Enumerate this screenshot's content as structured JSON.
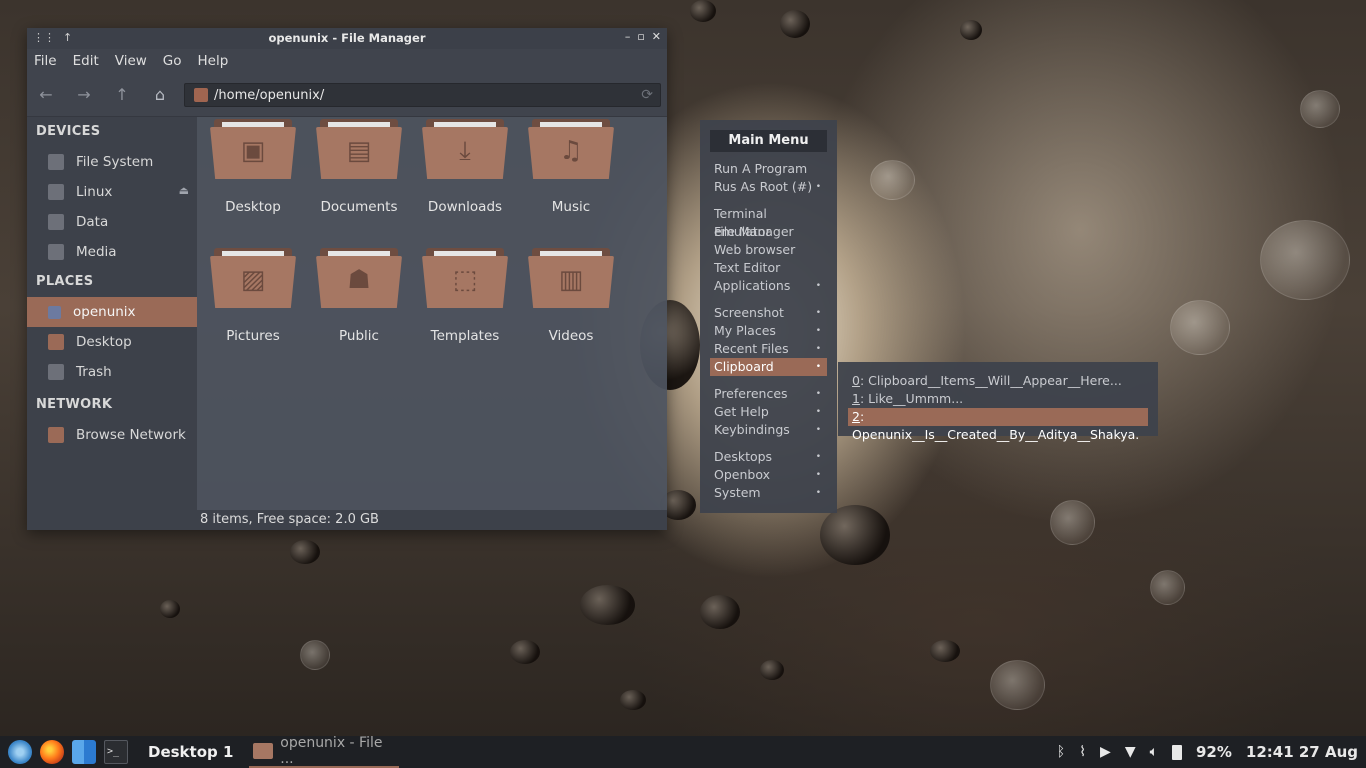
{
  "window": {
    "title": "openunix - File Manager",
    "menu": [
      "File",
      "Edit",
      "View",
      "Go",
      "Help"
    ],
    "path": "/home/openunix/",
    "status": "8 items, Free space: 2.0 GB"
  },
  "sidebar": {
    "devices_header": "DEVICES",
    "devices": [
      "File System",
      "Linux",
      "Data",
      "Media"
    ],
    "places_header": "PLACES",
    "places": [
      "openunix",
      "Desktop",
      "Trash"
    ],
    "network_header": "NETWORK",
    "network": [
      "Browse Network"
    ]
  },
  "folders": [
    {
      "label": "Desktop",
      "icon": "monitor-icon"
    },
    {
      "label": "Documents",
      "icon": "document-icon"
    },
    {
      "label": "Downloads",
      "icon": "download-icon"
    },
    {
      "label": "Music",
      "icon": "music-icon"
    },
    {
      "label": "Pictures",
      "icon": "image-icon"
    },
    {
      "label": "Public",
      "icon": "people-icon"
    },
    {
      "label": "Templates",
      "icon": "template-icon"
    },
    {
      "label": "Videos",
      "icon": "film-icon"
    }
  ],
  "main_menu": {
    "title": "Main Menu",
    "groups": [
      [
        "Run A Program",
        "Rus As Root (#)"
      ],
      [
        "Terminal emulator",
        "File Manager",
        "Web browser",
        "Text Editor",
        "Applications"
      ],
      [
        "Screenshot",
        "My Places",
        "Recent Files",
        "Clipboard"
      ],
      [
        "Preferences",
        "Get Help",
        "Keybindings"
      ],
      [
        "Desktops",
        "Openbox",
        "System"
      ]
    ],
    "submenu_items": [
      "Rus As Root (#)",
      "Applications",
      "Screenshot",
      "My Places",
      "Recent Files",
      "Clipboard",
      "Preferences",
      "Get Help",
      "Keybindings",
      "Desktops",
      "Openbox",
      "System"
    ],
    "selected": "Clipboard"
  },
  "clipboard_menu": [
    {
      "key": "0",
      "text": ": Clipboard__Items__Will__Appear__Here..."
    },
    {
      "key": "1",
      "text": ": Like__Ummm..."
    },
    {
      "key": "2",
      "text": ": Openunix__Is__Created__By__Aditya__Shakya."
    }
  ],
  "taskbar": {
    "desktop": "Desktop 1",
    "task": "openunix - File ...",
    "battery": "92%",
    "clock": "12:41 27 Aug"
  },
  "colors": {
    "accent": "#9a6a57",
    "folder": "#a67763",
    "panel": "#40444d"
  }
}
